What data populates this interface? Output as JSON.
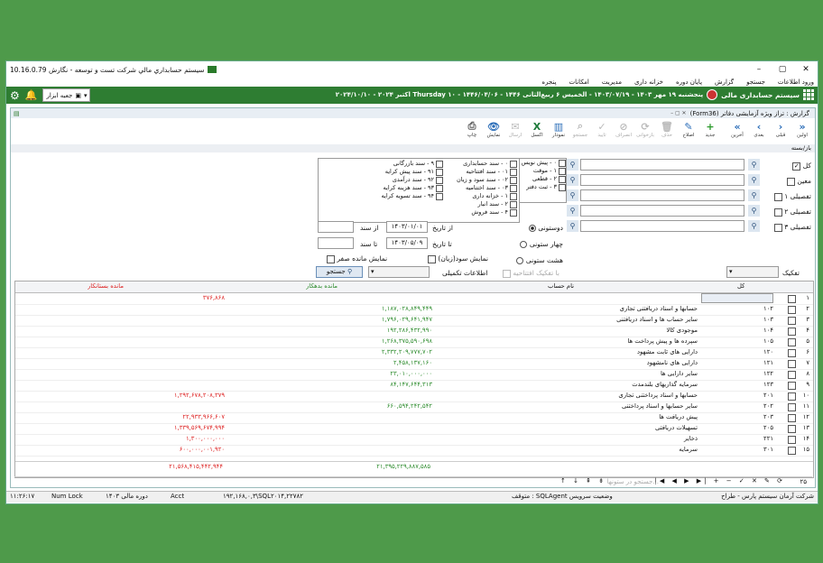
{
  "window": {
    "title": "سيستم حسابداري مالي شرکت تست و توسعه - نگارش 10.16.0.79",
    "menu": [
      "ورود اطلاعات",
      "جستجو",
      "گزارش",
      "پایان دوره",
      "خزانه داری",
      "مدیریت",
      "امکانات",
      "پنجره"
    ]
  },
  "greenbar": {
    "app_name": "سیستم حسابداری مالی",
    "date_line": "پنجشنبه ۱۹ مهر ۱۴۰۳ - ۱۴۰۳/۰۷/۱۹ - الخمیس ۶ ربیع‌الثانی ۱۴۴۶ - ۱۴۴۶/۰۴/۰۶ - Thursday ۱۰ اکتبر ۲۰۲۴ - ۲۰۲۴/۱۰/۱۰",
    "tools_label": "جعبه ابزار"
  },
  "inner": {
    "title": "گزارش : تراز ویژه آزمایشی دفاتر (Form36)",
    "baz_label": "باز/بسته"
  },
  "toolbar": [
    {
      "label": "اولین",
      "icon": "first-icon",
      "glyph": "«",
      "enabled": true
    },
    {
      "label": "قبلی",
      "icon": "prev-icon",
      "glyph": "‹",
      "enabled": true
    },
    {
      "label": "بعدی",
      "icon": "next-icon",
      "glyph": "›",
      "enabled": true
    },
    {
      "label": "آخرین",
      "icon": "last-icon",
      "glyph": "»",
      "enabled": true
    },
    {
      "label": "جدید",
      "icon": "plus-icon",
      "glyph": "+",
      "enabled": true
    },
    {
      "label": "اصلاح",
      "icon": "edit-icon",
      "glyph": "✎",
      "enabled": true
    },
    {
      "label": "حذف",
      "icon": "delete-icon",
      "glyph": "🗑",
      "enabled": false
    },
    {
      "label": "بازخوانی",
      "icon": "refresh-icon",
      "glyph": "⟳",
      "enabled": false
    },
    {
      "label": "انصراف",
      "icon": "cancel-icon",
      "glyph": "⊘",
      "enabled": false
    },
    {
      "label": "تایید",
      "icon": "confirm-icon",
      "glyph": "✓",
      "enabled": false
    },
    {
      "label": "جستجو",
      "icon": "search-icon",
      "glyph": "⌕",
      "enabled": false
    },
    {
      "label": "نمودار",
      "icon": "chart-icon",
      "glyph": "▥",
      "enabled": true
    },
    {
      "label": "اکسل",
      "icon": "excel-icon",
      "glyph": "X",
      "enabled": true
    },
    {
      "label": "ارسال",
      "icon": "send-icon",
      "glyph": "✉",
      "enabled": false
    },
    {
      "label": "نمایش",
      "icon": "view-icon",
      "glyph": "👁",
      "enabled": true
    },
    {
      "label": "چاپ",
      "icon": "print-icon",
      "glyph": "⎙",
      "enabled": true
    }
  ],
  "filters": {
    "levels": [
      {
        "label": "کل",
        "checked": true
      },
      {
        "label": "معین",
        "checked": false
      },
      {
        "label": "تفصیلی ۱",
        "checked": false
      },
      {
        "label": "تفصیلی ۲",
        "checked": false
      },
      {
        "label": "تفصیلی ۳",
        "checked": false
      }
    ],
    "status_list": [
      "۰ - پیش نویس",
      "۱ - موقت",
      "۲ - قطعی",
      "۳ - ثبت دفتر"
    ],
    "doc_types_a": [
      "۰ - سند حسابداری",
      "۰۱ - سند افتتاحیه",
      "۰۲ - سند سود و زیان",
      "۰۳ - سند اختتامیه",
      "۱ - خزانه داری",
      "۲ - سند انبار",
      "۴ - سند فروش"
    ],
    "doc_types_b": [
      "۹ - سند بازرگانی",
      "۹۱ - سند پیش کرایه",
      "۹۲ - سند درآمدی",
      "۹۳ - سند هزینه کرایه",
      "۹۴ - سند تسویه کرایه"
    ],
    "from_date_label": "از تاریخ",
    "from_date": "۱۴۰۳/۰۱/۰۱",
    "to_date_label": "تا تاریخ",
    "to_date": "۱۴۰۳/۰۵/۰۹",
    "from_doc_label": "از سند",
    "to_doc_label": "تا سند",
    "columns_options": [
      {
        "label": "دوستونی",
        "checked": true
      },
      {
        "label": "چهار ستونی",
        "checked": false
      },
      {
        "label": "هشت ستونی",
        "checked": false
      }
    ],
    "show_profit_label": "نمایش سود(زیان)",
    "show_zero_label": "نمایش مانده صفر",
    "extra_info_label": "اطلاعات تکمیلی",
    "split_opening_label": "با تفکیک افتتاحیه",
    "search_button": "جستجو",
    "breakdown_label": "تفکیک"
  },
  "grid": {
    "headers": {
      "kol": "کل",
      "name": "نام حساب",
      "debit": "مانده بدهکار",
      "credit": "مانده بستانکار"
    },
    "rows": [
      {
        "n": "۱",
        "code": "",
        "name": "",
        "debit": "",
        "credit": "۳۷۶,۸۶۸"
      },
      {
        "n": "۲",
        "code": "۱۰۲",
        "name": "حسابها و اسناد دریافتنی تجاری",
        "debit": "۱,۱۸۷,۰۲۸,۸۴۹,۴۴۹",
        "credit": ""
      },
      {
        "n": "۳",
        "code": "۱۰۳",
        "name": "سایر حساب ها و اسناد دریافتنی",
        "debit": "۱,۷۹۶,۰۲۹,۶۴۱,۹۴۷",
        "credit": ""
      },
      {
        "n": "۴",
        "code": "۱۰۴",
        "name": "موجودی کالا",
        "debit": "۱۹۲,۲۸۶,۴۳۲,۹۹۰",
        "credit": ""
      },
      {
        "n": "۵",
        "code": "۱۰۵",
        "name": "سپرده ها و پیش پرداخت ها",
        "debit": "۱,۲۶۸,۳۷۵,۵۹۰,۶۹۸",
        "credit": ""
      },
      {
        "n": "۶",
        "code": "۱۲۰",
        "name": "دارایی های ثابت مشهود",
        "debit": "۲,۳۳۲,۲۰۹,۷۷۷,۷۰۲",
        "credit": ""
      },
      {
        "n": "۷",
        "code": "۱۲۱",
        "name": "دارایی های نامشهود",
        "debit": "۲,۴۵۸,۱۳۷,۱۶۰",
        "credit": ""
      },
      {
        "n": "۸",
        "code": "۱۲۲",
        "name": "سایر دارایی ها",
        "debit": "۲۳,۰۱۰,۰۰۰,۰۰۰",
        "credit": ""
      },
      {
        "n": "۹",
        "code": "۱۲۳",
        "name": "سرمایه گذاریهای بلندمدت",
        "debit": "۸۴,۱۴۷,۶۴۴,۳۱۳",
        "credit": ""
      },
      {
        "n": "۱۰",
        "code": "۲۰۱",
        "name": "حسابها و اسناد پرداختنی تجاری",
        "debit": "",
        "credit": "۱,۲۹۲,۶۷۸,۲۰۸,۳۷۹"
      },
      {
        "n": "۱۱",
        "code": "۲۰۲",
        "name": "سایر حسابها و اسناد پرداختنی",
        "debit": "۶۶۰,۵۹۴,۲۴۲,۵۴۲",
        "credit": ""
      },
      {
        "n": "۱۲",
        "code": "۲۰۳",
        "name": "پیش دریافت ها",
        "debit": "",
        "credit": "۲۲,۹۳۳,۹۶۶,۶۰۷"
      },
      {
        "n": "۱۳",
        "code": "۲۰۵",
        "name": "تسهیلات دریافتی",
        "debit": "",
        "credit": "۱,۳۳۹,۵۶۹,۶۷۴,۹۹۴"
      },
      {
        "n": "۱۴",
        "code": "۲۲۱",
        "name": "ذخایر",
        "debit": "",
        "credit": "۱,۳۰۰,۰۰۰,۰۰۰"
      },
      {
        "n": "۱۵",
        "code": "۳۰۱",
        "name": "سرمایه",
        "debit": "",
        "credit": "۶۰۰,۰۰۰,۰۰۱,۹۲۰"
      }
    ],
    "totals": {
      "debit": "۲۱,۳۹۵,۲۲۹,۸۸۷,۵۸۵",
      "credit": "۲۱,۵۶۸,۴۱۵,۴۴۲,۹۴۴"
    }
  },
  "pager": {
    "count": "۲۵",
    "search_placeholder": "جستجو در ستونها..."
  },
  "status": {
    "company": "شرکت آرمان سیستم پارس - طراح",
    "service": "متوقف : SQLAgent وضعیت سرویس",
    "server": "۱۹۲,۱۶۸,۰,۳\\SQL۲۰۱۴,۲۲۷۸۲",
    "user": "Acct",
    "period": "دوره مالی ۱۴۰۳",
    "numlock": "Num Lock",
    "time": "۱۱:۲۶:۱۷"
  }
}
